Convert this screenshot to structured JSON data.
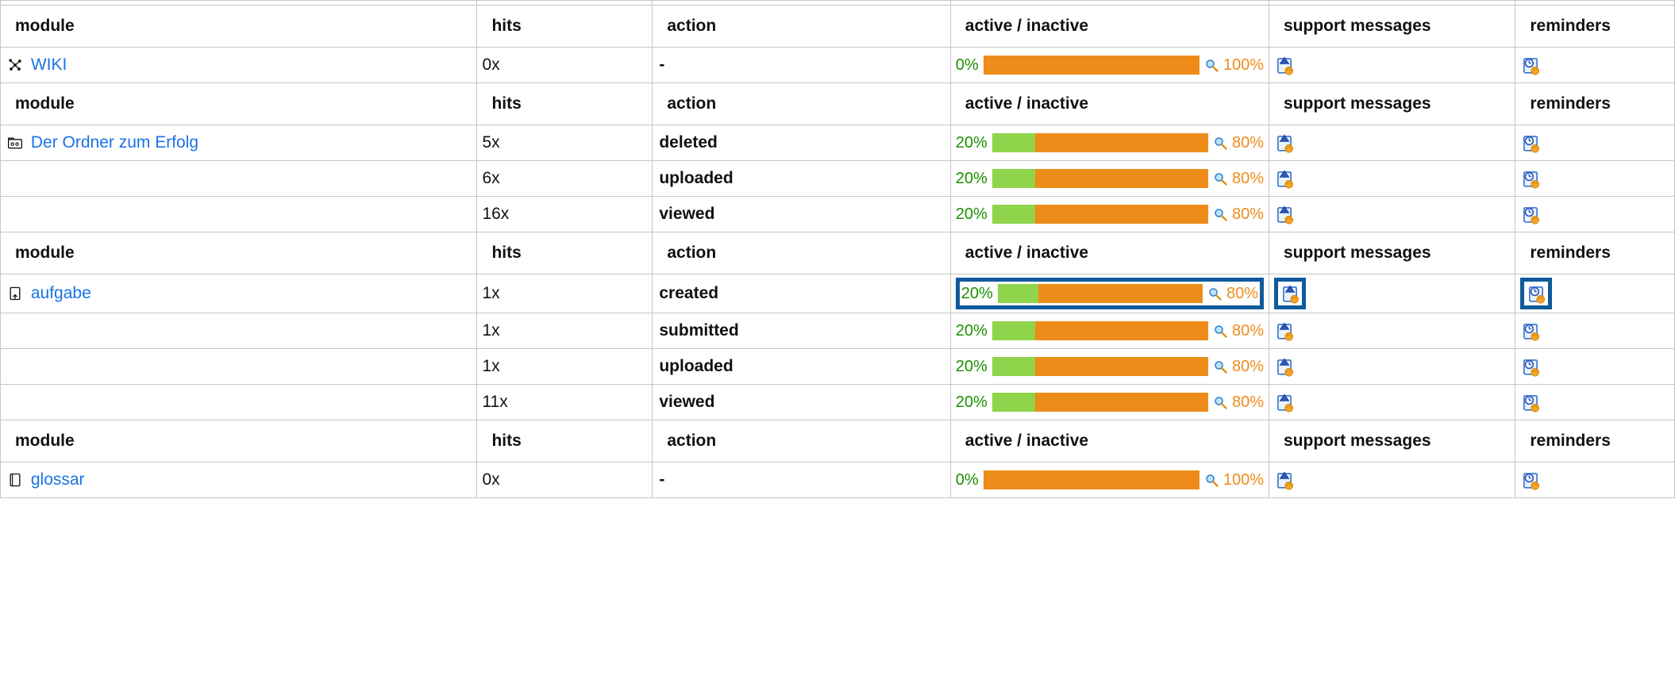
{
  "headers": {
    "module": "module",
    "hits": "hits",
    "action": "action",
    "active": "active / inactive",
    "support": "support messages",
    "reminders": "reminders"
  },
  "sections": [
    {
      "rows": [
        {
          "module_icon": "wiki-icon",
          "module_label": "WIKI",
          "hits": "0x",
          "action": "-",
          "active_pct": 0,
          "inactive_pct": 100,
          "highlight": false
        }
      ]
    },
    {
      "rows": [
        {
          "module_icon": "folder-icon",
          "module_label": "Der Ordner zum Erfolg",
          "hits": "5x",
          "action": "deleted",
          "active_pct": 20,
          "inactive_pct": 80,
          "highlight": false
        },
        {
          "module_icon": "",
          "module_label": "",
          "hits": "6x",
          "action": "uploaded",
          "active_pct": 20,
          "inactive_pct": 80,
          "highlight": false
        },
        {
          "module_icon": "",
          "module_label": "",
          "hits": "16x",
          "action": "viewed",
          "active_pct": 20,
          "inactive_pct": 80,
          "highlight": false
        }
      ]
    },
    {
      "rows": [
        {
          "module_icon": "assignment-icon",
          "module_label": "aufgabe",
          "hits": "1x",
          "action": "created",
          "active_pct": 20,
          "inactive_pct": 80,
          "highlight": true
        },
        {
          "module_icon": "",
          "module_label": "",
          "hits": "1x",
          "action": "submitted",
          "active_pct": 20,
          "inactive_pct": 80,
          "highlight": false
        },
        {
          "module_icon": "",
          "module_label": "",
          "hits": "1x",
          "action": "uploaded",
          "active_pct": 20,
          "inactive_pct": 80,
          "highlight": false
        },
        {
          "module_icon": "",
          "module_label": "",
          "hits": "11x",
          "action": "viewed",
          "active_pct": 20,
          "inactive_pct": 80,
          "highlight": false
        }
      ]
    },
    {
      "rows": [
        {
          "module_icon": "glossary-icon",
          "module_label": "glossar",
          "hits": "0x",
          "action": "-",
          "active_pct": 0,
          "inactive_pct": 100,
          "highlight": false
        }
      ]
    }
  ]
}
